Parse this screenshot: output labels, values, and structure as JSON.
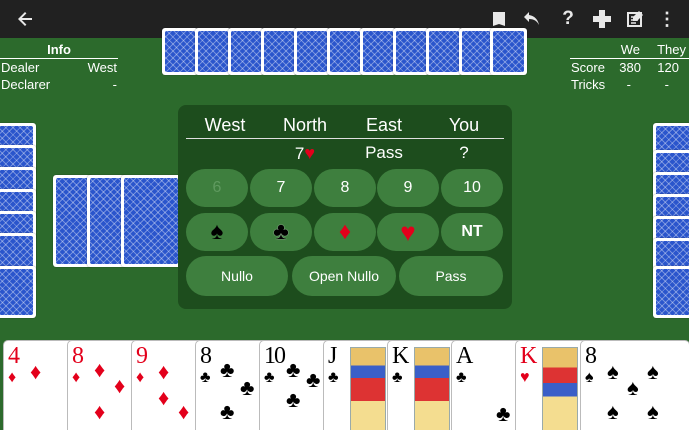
{
  "toolbar": {
    "back_icon": "arrow-left-icon",
    "actions": [
      "deck-icon",
      "undo-icon",
      "help-icon",
      "plus-icon",
      "edit-icon",
      "more-vert-icon"
    ],
    "help_glyph": "?",
    "more_glyph": "⋮"
  },
  "info": {
    "title": "Info",
    "rows": [
      {
        "label": "Dealer",
        "value": "West"
      },
      {
        "label": "Declarer",
        "value": "-"
      }
    ]
  },
  "score": {
    "col_we": "We",
    "col_they": "They",
    "rows": [
      {
        "label": "Score",
        "we": "380",
        "they": "120"
      },
      {
        "label": "Tricks",
        "we": "-",
        "they": "-"
      }
    ]
  },
  "bidding": {
    "players": [
      "West",
      "North",
      "East",
      "You"
    ],
    "bids": [
      "",
      "7",
      "Pass",
      "?"
    ],
    "north_bid_suit": "♥",
    "levels": [
      "6",
      "7",
      "8",
      "9",
      "10"
    ],
    "suits": [
      "♠",
      "♣",
      "♦",
      "♥"
    ],
    "nt_label": "NT",
    "special": [
      "Nullo",
      "Open Nullo",
      "Pass"
    ]
  },
  "hand": [
    {
      "rank": "4",
      "suit": "♦",
      "color": "red"
    },
    {
      "rank": "8",
      "suit": "♦",
      "color": "red"
    },
    {
      "rank": "9",
      "suit": "♦",
      "color": "red"
    },
    {
      "rank": "8",
      "suit": "♣",
      "color": "black"
    },
    {
      "rank": "10",
      "suit": "♣",
      "color": "black"
    },
    {
      "rank": "J",
      "suit": "♣",
      "color": "black"
    },
    {
      "rank": "K",
      "suit": "♣",
      "color": "black"
    },
    {
      "rank": "A",
      "suit": "♣",
      "color": "black"
    },
    {
      "rank": "K",
      "suit": "♥",
      "color": "red"
    },
    {
      "rank": "8",
      "suit": "♠",
      "color": "black"
    }
  ],
  "colors": {
    "table": "#2c6a2c",
    "bidbox": "#1d4d1d",
    "button": "#3e7f3e",
    "red": "#e3001b",
    "toolbar": "#212121"
  }
}
